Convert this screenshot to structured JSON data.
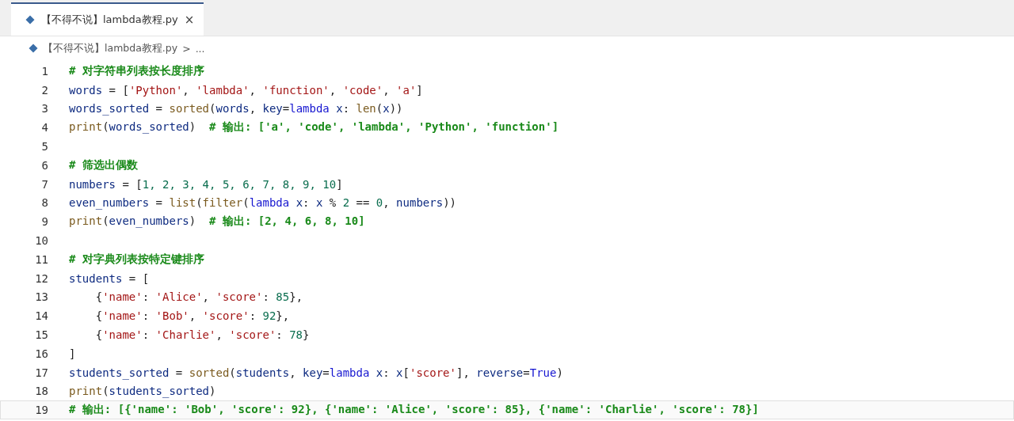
{
  "tab": {
    "label": "【不得不说】lambda教程.py",
    "close": "×",
    "selected": true
  },
  "breadcrumb": {
    "file": "【不得不说】lambda教程.py",
    "separator": ">",
    "more": "..."
  },
  "lines": [
    {
      "number": "1",
      "current": false,
      "tokens": [
        {
          "kind": "cmt",
          "text": "# 对字符串列表按长度排序"
        }
      ]
    },
    {
      "number": "2",
      "current": false,
      "tokens": [
        {
          "kind": "var",
          "text": "words"
        },
        {
          "kind": "op",
          "text": " = ["
        },
        {
          "kind": "str",
          "text": "'Python'"
        },
        {
          "kind": "op",
          "text": ", "
        },
        {
          "kind": "str",
          "text": "'lambda'"
        },
        {
          "kind": "op",
          "text": ", "
        },
        {
          "kind": "str",
          "text": "'function'"
        },
        {
          "kind": "op",
          "text": ", "
        },
        {
          "kind": "str",
          "text": "'code'"
        },
        {
          "kind": "op",
          "text": ", "
        },
        {
          "kind": "str",
          "text": "'a'"
        },
        {
          "kind": "op",
          "text": "]"
        }
      ]
    },
    {
      "number": "3",
      "current": false,
      "tokens": [
        {
          "kind": "var",
          "text": "words_sorted"
        },
        {
          "kind": "op",
          "text": " = "
        },
        {
          "kind": "fn",
          "text": "sorted"
        },
        {
          "kind": "op",
          "text": "("
        },
        {
          "kind": "var",
          "text": "words"
        },
        {
          "kind": "op",
          "text": ", "
        },
        {
          "kind": "var",
          "text": "key"
        },
        {
          "kind": "op",
          "text": "="
        },
        {
          "kind": "kw",
          "text": "lambda"
        },
        {
          "kind": "var",
          "text": " x"
        },
        {
          "kind": "op",
          "text": ": "
        },
        {
          "kind": "fn",
          "text": "len"
        },
        {
          "kind": "op",
          "text": "("
        },
        {
          "kind": "var",
          "text": "x"
        },
        {
          "kind": "op",
          "text": "))"
        }
      ]
    },
    {
      "number": "4",
      "current": false,
      "tokens": [
        {
          "kind": "fn",
          "text": "print"
        },
        {
          "kind": "op",
          "text": "("
        },
        {
          "kind": "var",
          "text": "words_sorted"
        },
        {
          "kind": "op",
          "text": ")  "
        },
        {
          "kind": "cmt",
          "text": "# 输出: ['a', 'code', 'lambda', 'Python', 'function']"
        }
      ]
    },
    {
      "number": "5",
      "current": false
    },
    {
      "number": "6",
      "current": false,
      "tokens": [
        {
          "kind": "cmt",
          "text": "# 筛选出偶数"
        }
      ]
    },
    {
      "number": "7",
      "current": false,
      "tokens": [
        {
          "kind": "var",
          "text": "numbers"
        },
        {
          "kind": "op",
          "text": " = ["
        },
        {
          "kind": "num",
          "text": "1, 2, 3, 4, 5, 6, 7, 8, 9, 10"
        },
        {
          "kind": "op",
          "text": "]"
        }
      ]
    },
    {
      "number": "8",
      "current": false,
      "tokens": [
        {
          "kind": "var",
          "text": "even_numbers"
        },
        {
          "kind": "op",
          "text": " = "
        },
        {
          "kind": "fn",
          "text": "list"
        },
        {
          "kind": "op",
          "text": "("
        },
        {
          "kind": "fn",
          "text": "filter"
        },
        {
          "kind": "op",
          "text": "("
        },
        {
          "kind": "kw",
          "text": "lambda"
        },
        {
          "kind": "var",
          "text": " x"
        },
        {
          "kind": "op",
          "text": ": "
        },
        {
          "kind": "var",
          "text": "x"
        },
        {
          "kind": "op",
          "text": " % "
        },
        {
          "kind": "num",
          "text": "2"
        },
        {
          "kind": "op",
          "text": " == "
        },
        {
          "kind": "num",
          "text": "0"
        },
        {
          "kind": "op",
          "text": ", "
        },
        {
          "kind": "var",
          "text": "numbers"
        },
        {
          "kind": "op",
          "text": "))"
        }
      ]
    },
    {
      "number": "9",
      "current": false,
      "tokens": [
        {
          "kind": "fn",
          "text": "print"
        },
        {
          "kind": "op",
          "text": "("
        },
        {
          "kind": "var",
          "text": "even_numbers"
        },
        {
          "kind": "op",
          "text": ")  "
        },
        {
          "kind": "cmt",
          "text": "# 输出: [2, 4, 6, 8, 10]"
        }
      ]
    },
    {
      "number": "10",
      "current": false
    },
    {
      "number": "11",
      "current": false,
      "tokens": [
        {
          "kind": "cmt",
          "text": "# 对字典列表按特定键排序"
        }
      ]
    },
    {
      "number": "12",
      "current": false,
      "tokens": [
        {
          "kind": "var",
          "text": "students"
        },
        {
          "kind": "op",
          "text": " = ["
        }
      ]
    },
    {
      "number": "13",
      "current": false,
      "tokens": [
        {
          "kind": "op",
          "text": "    {"
        },
        {
          "kind": "str",
          "text": "'name'"
        },
        {
          "kind": "op",
          "text": ": "
        },
        {
          "kind": "str",
          "text": "'Alice'"
        },
        {
          "kind": "op",
          "text": ", "
        },
        {
          "kind": "str",
          "text": "'score'"
        },
        {
          "kind": "op",
          "text": ": "
        },
        {
          "kind": "num",
          "text": "85"
        },
        {
          "kind": "op",
          "text": "},"
        }
      ]
    },
    {
      "number": "14",
      "current": false,
      "tokens": [
        {
          "kind": "op",
          "text": "    {"
        },
        {
          "kind": "str",
          "text": "'name'"
        },
        {
          "kind": "op",
          "text": ": "
        },
        {
          "kind": "str",
          "text": "'Bob'"
        },
        {
          "kind": "op",
          "text": ", "
        },
        {
          "kind": "str",
          "text": "'score'"
        },
        {
          "kind": "op",
          "text": ": "
        },
        {
          "kind": "num",
          "text": "92"
        },
        {
          "kind": "op",
          "text": "},"
        }
      ]
    },
    {
      "number": "15",
      "current": false,
      "tokens": [
        {
          "kind": "op",
          "text": "    {"
        },
        {
          "kind": "str",
          "text": "'name'"
        },
        {
          "kind": "op",
          "text": ": "
        },
        {
          "kind": "str",
          "text": "'Charlie'"
        },
        {
          "kind": "op",
          "text": ", "
        },
        {
          "kind": "str",
          "text": "'score'"
        },
        {
          "kind": "op",
          "text": ": "
        },
        {
          "kind": "num",
          "text": "78"
        },
        {
          "kind": "op",
          "text": "}"
        }
      ]
    },
    {
      "number": "16",
      "current": false,
      "tokens": [
        {
          "kind": "op",
          "text": "]"
        }
      ]
    },
    {
      "number": "17",
      "current": false,
      "tokens": [
        {
          "kind": "var",
          "text": "students_sorted"
        },
        {
          "kind": "op",
          "text": " = "
        },
        {
          "kind": "fn",
          "text": "sorted"
        },
        {
          "kind": "op",
          "text": "("
        },
        {
          "kind": "var",
          "text": "students"
        },
        {
          "kind": "op",
          "text": ", "
        },
        {
          "kind": "var",
          "text": "key"
        },
        {
          "kind": "op",
          "text": "="
        },
        {
          "kind": "kw",
          "text": "lambda"
        },
        {
          "kind": "var",
          "text": " x"
        },
        {
          "kind": "op",
          "text": ": "
        },
        {
          "kind": "var",
          "text": "x"
        },
        {
          "kind": "op",
          "text": "["
        },
        {
          "kind": "str",
          "text": "'score'"
        },
        {
          "kind": "op",
          "text": "], "
        },
        {
          "kind": "var",
          "text": "reverse"
        },
        {
          "kind": "op",
          "text": "="
        },
        {
          "kind": "kw",
          "text": "True"
        },
        {
          "kind": "op",
          "text": ")"
        }
      ]
    },
    {
      "number": "18",
      "current": false,
      "tokens": [
        {
          "kind": "fn",
          "text": "print"
        },
        {
          "kind": "op",
          "text": "("
        },
        {
          "kind": "var",
          "text": "students_sorted"
        },
        {
          "kind": "op",
          "text": ")"
        }
      ]
    },
    {
      "number": "19",
      "current": true,
      "tokens": [
        {
          "kind": "cmt",
          "text": "# 输出: [{'name': 'Bob', 'score': 92}, {'name': 'Alice', 'score': 85}, {'name': 'Charlie', 'score': 78}]"
        }
      ]
    }
  ]
}
